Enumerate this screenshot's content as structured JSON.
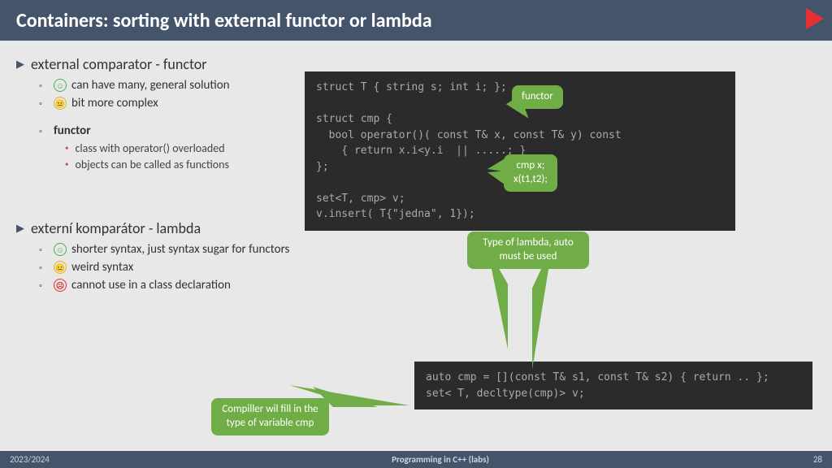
{
  "header": {
    "title": "Containers: sorting with external functor or lambda"
  },
  "sec1": {
    "title": "external comparator - functor",
    "b1": "can have many, general solution",
    "b2": "bit more complex",
    "b3": "functor",
    "s1": "class with operator() overloaded",
    "s2": "objects can be called as functions"
  },
  "sec2": {
    "title": "externí komparátor - lambda",
    "b1": "shorter syntax, just syntax sugar for functors",
    "b2": "weird syntax",
    "b3": "cannot use in a class declaration"
  },
  "code1": "struct T { string s; int i; };\n\nstruct cmp {\n  bool operator()( const T& x, const T& y) const\n    { return x.i<y.i  || .....; }\n};\n\nset<T, cmp> v;\nv.insert( T{\"jedna\", 1});",
  "code2": "auto cmp = [](const T& s1, const T& s2) { return .. };\nset< T, decltype(cmp)> v;",
  "callouts": {
    "functor": "functor",
    "cmp": "cmp x;\nx(t1,t2);",
    "type": "Type of lambda, auto must be used",
    "compiler": "Compiller wil fill in the type of variable cmp"
  },
  "footer": {
    "left": "2023/2024",
    "center": "Programming in C++ (labs)",
    "right": "28"
  }
}
